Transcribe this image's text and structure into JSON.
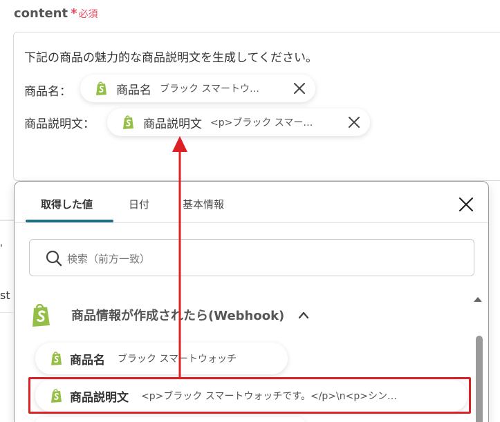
{
  "field": {
    "label": "content",
    "required_star": "*",
    "required_text": "必須"
  },
  "editor": {
    "line1": "下記の商品の魅力的な商品説明文を生成してください。",
    "rows": [
      {
        "label": "商品名：",
        "pill_name": "商品名",
        "pill_value": "ブラック スマートウ…"
      },
      {
        "label": "商品説明文：",
        "pill_name": "商品説明文",
        "pill_value": "<p>ブラック スマー…"
      }
    ]
  },
  "picker": {
    "tabs": [
      "取得した値",
      "日付",
      "基本情報"
    ],
    "active_tab": "取得した値",
    "search_placeholder": "検索（前方一致）",
    "group_title": "商品情報が作成されたら(Webhook)",
    "items": [
      {
        "name": "商品名",
        "value": "ブラック スマートウォッチ"
      },
      {
        "name": "商品説明文",
        "value": "<p>ブラック スマートウォッチです。</p>\\n<p>シン…"
      }
    ]
  },
  "background": {
    "partial_text": "st"
  },
  "colors": {
    "accent": "#1f6f82",
    "highlight": "#dd1f26",
    "required": "#e8455a",
    "shopify_green": "#95bf47"
  },
  "icons": [
    "shopify-icon",
    "close-icon",
    "search-icon",
    "chevron-up-icon"
  ]
}
